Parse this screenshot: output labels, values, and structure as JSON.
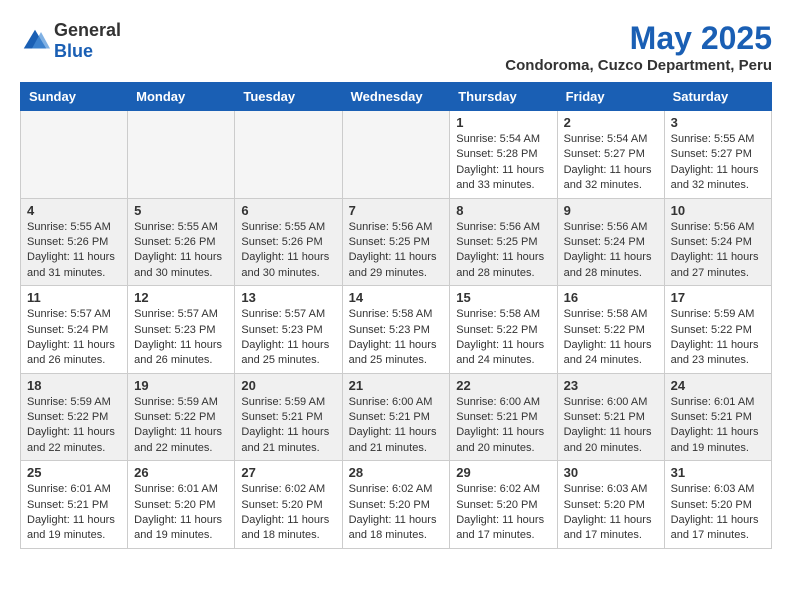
{
  "logo": {
    "general": "General",
    "blue": "Blue"
  },
  "title": "May 2025",
  "subtitle": "Condoroma, Cuzco Department, Peru",
  "headers": [
    "Sunday",
    "Monday",
    "Tuesday",
    "Wednesday",
    "Thursday",
    "Friday",
    "Saturday"
  ],
  "weeks": [
    [
      {
        "day": "",
        "empty": true
      },
      {
        "day": "",
        "empty": true
      },
      {
        "day": "",
        "empty": true
      },
      {
        "day": "",
        "empty": true
      },
      {
        "day": "1",
        "info": "Sunrise: 5:54 AM\nSunset: 5:28 PM\nDaylight: 11 hours\nand 33 minutes."
      },
      {
        "day": "2",
        "info": "Sunrise: 5:54 AM\nSunset: 5:27 PM\nDaylight: 11 hours\nand 32 minutes."
      },
      {
        "day": "3",
        "info": "Sunrise: 5:55 AM\nSunset: 5:27 PM\nDaylight: 11 hours\nand 32 minutes."
      }
    ],
    [
      {
        "day": "4",
        "info": "Sunrise: 5:55 AM\nSunset: 5:26 PM\nDaylight: 11 hours\nand 31 minutes.",
        "shaded": true
      },
      {
        "day": "5",
        "info": "Sunrise: 5:55 AM\nSunset: 5:26 PM\nDaylight: 11 hours\nand 30 minutes.",
        "shaded": true
      },
      {
        "day": "6",
        "info": "Sunrise: 5:55 AM\nSunset: 5:26 PM\nDaylight: 11 hours\nand 30 minutes.",
        "shaded": true
      },
      {
        "day": "7",
        "info": "Sunrise: 5:56 AM\nSunset: 5:25 PM\nDaylight: 11 hours\nand 29 minutes.",
        "shaded": true
      },
      {
        "day": "8",
        "info": "Sunrise: 5:56 AM\nSunset: 5:25 PM\nDaylight: 11 hours\nand 28 minutes.",
        "shaded": true
      },
      {
        "day": "9",
        "info": "Sunrise: 5:56 AM\nSunset: 5:24 PM\nDaylight: 11 hours\nand 28 minutes.",
        "shaded": true
      },
      {
        "day": "10",
        "info": "Sunrise: 5:56 AM\nSunset: 5:24 PM\nDaylight: 11 hours\nand 27 minutes.",
        "shaded": true
      }
    ],
    [
      {
        "day": "11",
        "info": "Sunrise: 5:57 AM\nSunset: 5:24 PM\nDaylight: 11 hours\nand 26 minutes."
      },
      {
        "day": "12",
        "info": "Sunrise: 5:57 AM\nSunset: 5:23 PM\nDaylight: 11 hours\nand 26 minutes."
      },
      {
        "day": "13",
        "info": "Sunrise: 5:57 AM\nSunset: 5:23 PM\nDaylight: 11 hours\nand 25 minutes."
      },
      {
        "day": "14",
        "info": "Sunrise: 5:58 AM\nSunset: 5:23 PM\nDaylight: 11 hours\nand 25 minutes."
      },
      {
        "day": "15",
        "info": "Sunrise: 5:58 AM\nSunset: 5:22 PM\nDaylight: 11 hours\nand 24 minutes."
      },
      {
        "day": "16",
        "info": "Sunrise: 5:58 AM\nSunset: 5:22 PM\nDaylight: 11 hours\nand 24 minutes."
      },
      {
        "day": "17",
        "info": "Sunrise: 5:59 AM\nSunset: 5:22 PM\nDaylight: 11 hours\nand 23 minutes."
      }
    ],
    [
      {
        "day": "18",
        "info": "Sunrise: 5:59 AM\nSunset: 5:22 PM\nDaylight: 11 hours\nand 22 minutes.",
        "shaded": true
      },
      {
        "day": "19",
        "info": "Sunrise: 5:59 AM\nSunset: 5:22 PM\nDaylight: 11 hours\nand 22 minutes.",
        "shaded": true
      },
      {
        "day": "20",
        "info": "Sunrise: 5:59 AM\nSunset: 5:21 PM\nDaylight: 11 hours\nand 21 minutes.",
        "shaded": true
      },
      {
        "day": "21",
        "info": "Sunrise: 6:00 AM\nSunset: 5:21 PM\nDaylight: 11 hours\nand 21 minutes.",
        "shaded": true
      },
      {
        "day": "22",
        "info": "Sunrise: 6:00 AM\nSunset: 5:21 PM\nDaylight: 11 hours\nand 20 minutes.",
        "shaded": true
      },
      {
        "day": "23",
        "info": "Sunrise: 6:00 AM\nSunset: 5:21 PM\nDaylight: 11 hours\nand 20 minutes.",
        "shaded": true
      },
      {
        "day": "24",
        "info": "Sunrise: 6:01 AM\nSunset: 5:21 PM\nDaylight: 11 hours\nand 19 minutes.",
        "shaded": true
      }
    ],
    [
      {
        "day": "25",
        "info": "Sunrise: 6:01 AM\nSunset: 5:21 PM\nDaylight: 11 hours\nand 19 minutes."
      },
      {
        "day": "26",
        "info": "Sunrise: 6:01 AM\nSunset: 5:20 PM\nDaylight: 11 hours\nand 19 minutes."
      },
      {
        "day": "27",
        "info": "Sunrise: 6:02 AM\nSunset: 5:20 PM\nDaylight: 11 hours\nand 18 minutes."
      },
      {
        "day": "28",
        "info": "Sunrise: 6:02 AM\nSunset: 5:20 PM\nDaylight: 11 hours\nand 18 minutes."
      },
      {
        "day": "29",
        "info": "Sunrise: 6:02 AM\nSunset: 5:20 PM\nDaylight: 11 hours\nand 17 minutes."
      },
      {
        "day": "30",
        "info": "Sunrise: 6:03 AM\nSunset: 5:20 PM\nDaylight: 11 hours\nand 17 minutes."
      },
      {
        "day": "31",
        "info": "Sunrise: 6:03 AM\nSunset: 5:20 PM\nDaylight: 11 hours\nand 17 minutes."
      }
    ]
  ]
}
